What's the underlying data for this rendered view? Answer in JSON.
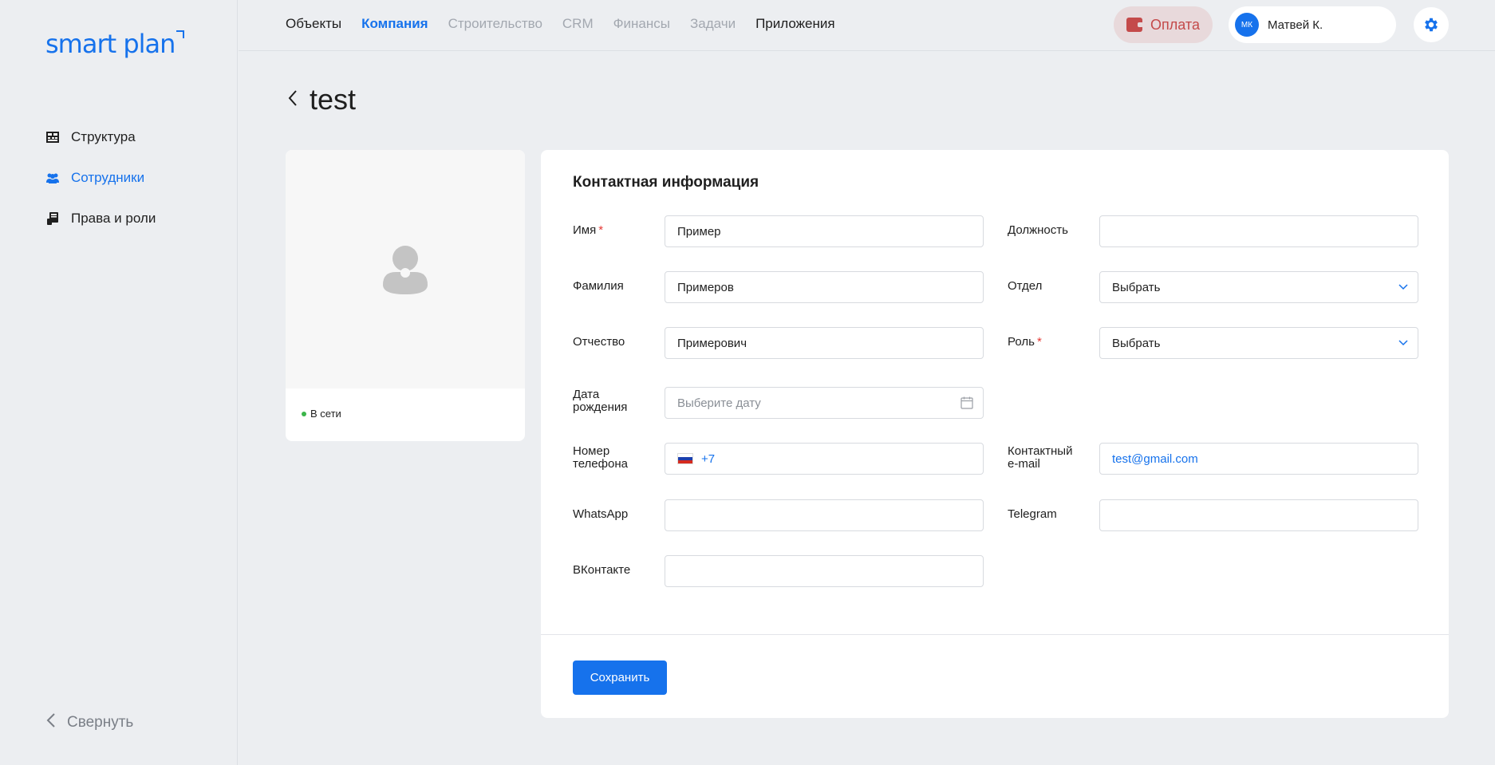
{
  "sidebar": {
    "logo": "smart plan",
    "items": [
      {
        "label": "Структура",
        "icon": "structure-icon"
      },
      {
        "label": "Сотрудники",
        "icon": "users-icon"
      },
      {
        "label": "Права и роли",
        "icon": "badge-icon"
      }
    ],
    "collapse_label": "Свернуть"
  },
  "topbar": {
    "nav": [
      "Объекты",
      "Компания",
      "Строительство",
      "CRM",
      "Финансы",
      "Задачи",
      "Приложения"
    ],
    "active_nav": "Компания",
    "pay_label": "Оплата",
    "user_initials": "МК",
    "user_name": "Матвей К."
  },
  "page": {
    "title": "test"
  },
  "profile": {
    "status": "В сети"
  },
  "form": {
    "title": "Контактная информация",
    "labels": {
      "first_name": "Имя",
      "last_name": "Фамилия",
      "patronymic": "Отчество",
      "birth_date_1": "Дата",
      "birth_date_2": "рождения",
      "phone_1": "Номер",
      "phone_2": "телефона",
      "whatsapp": "WhatsApp",
      "vk": "ВКонтакте",
      "position": "Должность",
      "department": "Отдел",
      "role": "Роль",
      "email_1": "Контактный",
      "email_2": "e-mail",
      "telegram": "Telegram"
    },
    "values": {
      "first_name": "Пример",
      "last_name": "Примеров",
      "patronymic": "Примерович",
      "birth_date_placeholder": "Выберите дату",
      "phone_code": "+7",
      "whatsapp": "",
      "vk": "",
      "position": "",
      "department": "Выбрать",
      "role": "Выбрать",
      "email": "test@gmail.com",
      "telegram": ""
    },
    "required_mark": "*",
    "save_label": "Сохранить"
  },
  "colors": {
    "accent": "#1672ec",
    "online": "#3bb54a",
    "pay": "#c44a4a"
  }
}
